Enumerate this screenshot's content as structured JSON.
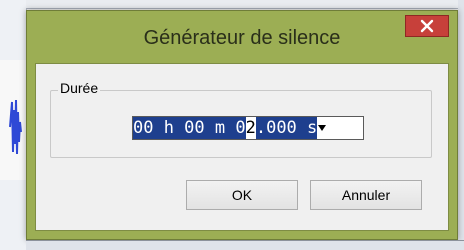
{
  "dialog": {
    "title": "Générateur de silence",
    "close_symbol": "×",
    "close_icon": "close-icon",
    "accent_color": "#9cae54",
    "close_color": "#c7403a"
  },
  "duration": {
    "label": "Durée",
    "value_parts": [
      "00 h 00 m 0",
      "2",
      ".000 s"
    ],
    "dropdown_icon": "chevron-down-icon"
  },
  "buttons": {
    "ok": "OK",
    "cancel": "Annuler"
  }
}
